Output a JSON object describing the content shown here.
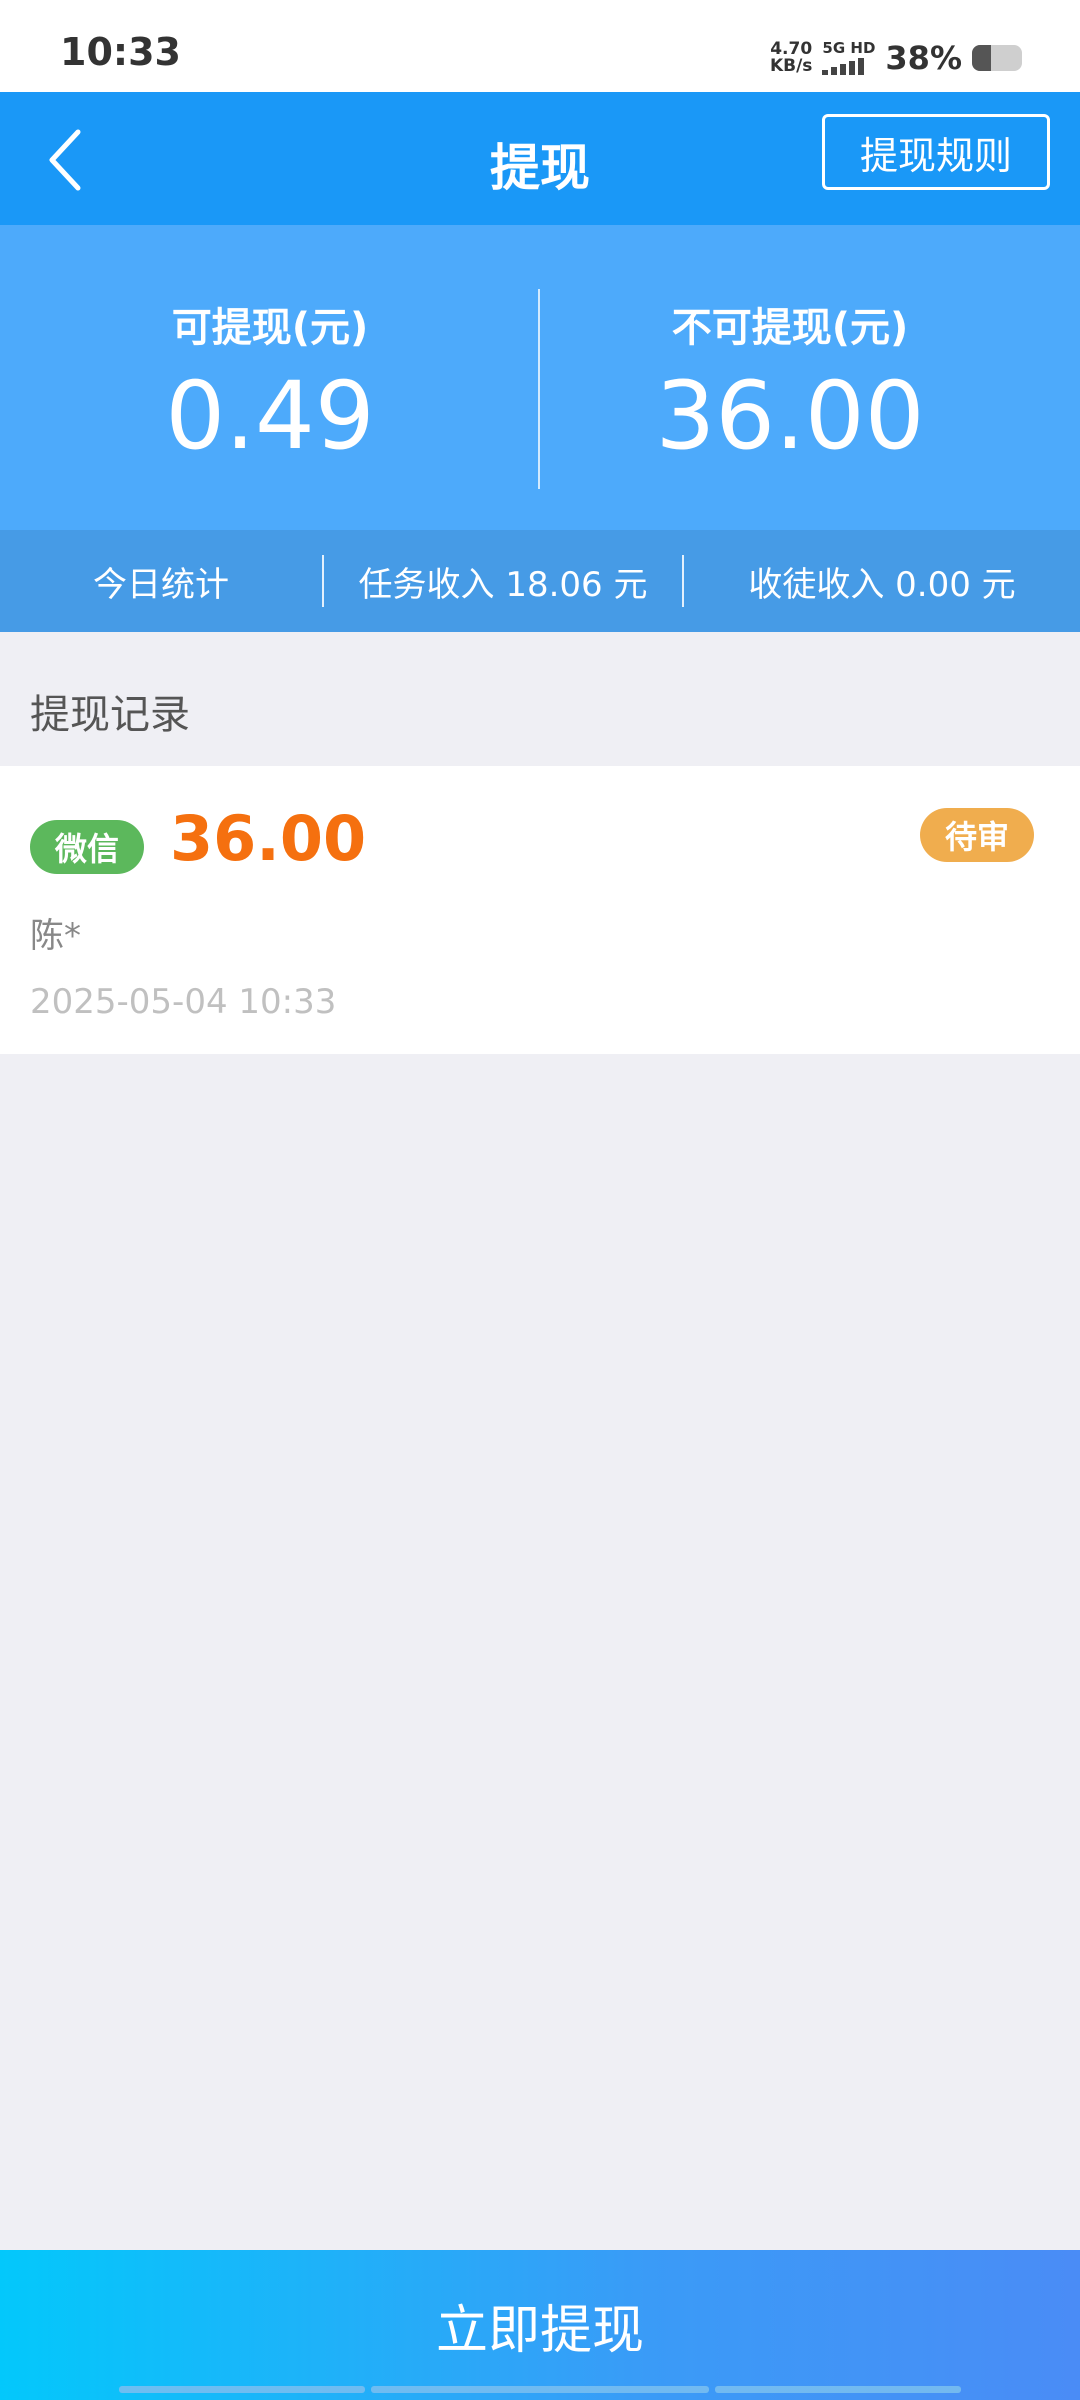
{
  "status_bar": {
    "time": "10:33",
    "net_speed_value": "4.70",
    "net_speed_unit": "KB/s",
    "signal_label": "5G HD",
    "battery_percent": "38%",
    "battery_level": 0.38
  },
  "nav": {
    "title": "提现",
    "rules_label": "提现规则",
    "back_icon": "chevron-left-icon"
  },
  "balance": {
    "available_label": "可提现(元)",
    "available_value": "0.49",
    "unavailable_label": "不可提现(元)",
    "unavailable_value": "36.00"
  },
  "stats": {
    "today_label": "今日统计",
    "task_income": "任务收入 18.06 元",
    "apprentice_income": "收徒收入 0.00 元"
  },
  "records": {
    "section_title": "提现记录",
    "items": [
      {
        "method": "微信",
        "amount": "36.00",
        "status": "待审",
        "name": "陈*",
        "time": "2025-05-04 10:33"
      }
    ]
  },
  "footer": {
    "withdraw_label": "立即提现"
  },
  "colors": {
    "nav_bg": "#1a98f7",
    "panel_bg": "#4daafb",
    "stats_bg": "#469be6",
    "amount_orange": "#f5700f",
    "wechat_green": "#5cb85c",
    "pending_orange": "#f0ad4e"
  }
}
